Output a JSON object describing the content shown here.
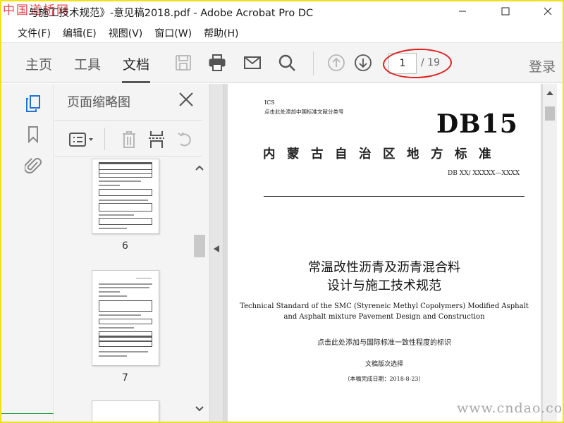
{
  "window": {
    "title": "与施工技术规范》-意见稿2018.pdf - Adobe Acrobat Pro DC",
    "watermark_top": "中国道桥网",
    "watermark_bottom": "www.cndao.com"
  },
  "menubar": {
    "items": [
      "文件(F)",
      "编辑(E)",
      "视图(V)",
      "窗口(W)",
      "帮助(H)"
    ]
  },
  "toolbar": {
    "tabs": [
      "主页",
      "工具",
      "文档"
    ],
    "active_tab": "文档",
    "tool_icons": [
      "save-icon",
      "print-icon",
      "email-icon",
      "search-icon",
      "page-up-icon",
      "page-down-icon"
    ],
    "current_page": "1",
    "total_pages": "/ 19",
    "login_label": "登录"
  },
  "side_rail": {
    "icons": [
      "copy-pages-icon",
      "bookmark-icon",
      "attachment-icon"
    ]
  },
  "thumbnail_panel": {
    "title": "页面缩略图",
    "tool_icons": [
      "thumbnail-options-icon",
      "delete-icon",
      "extract-icon",
      "rotate-icon"
    ],
    "pages": [
      "6",
      "7"
    ]
  },
  "document": {
    "ics": "ICS",
    "classification": "点击此处添加中国标准文献分类号",
    "db_code": "DB15",
    "standard_name": "内蒙古自治区地方标准",
    "std_number": "DB XX/ XXXXX—XXXX",
    "title_cn_line1": "常温改性沥青及沥青混合料",
    "title_cn_line2": "设计与施工技术规范",
    "title_en_line1": "Technical Standard of the SMC (Styreneic Methyl Copolymers) Modified Asphalt",
    "title_en_line2": "and Asphalt mixture Pavement Design and Construction",
    "intl_consistency": "点击此处添加与国际标准一致性程度的标识",
    "version": "文稿版次选择",
    "completion_date": "（本稿完成日期：2018-8-23）"
  },
  "colors": {
    "accent_red": "#e02020",
    "frame_yellow": "#f2e11a",
    "toolbar_bg": "#f4f4f4"
  }
}
